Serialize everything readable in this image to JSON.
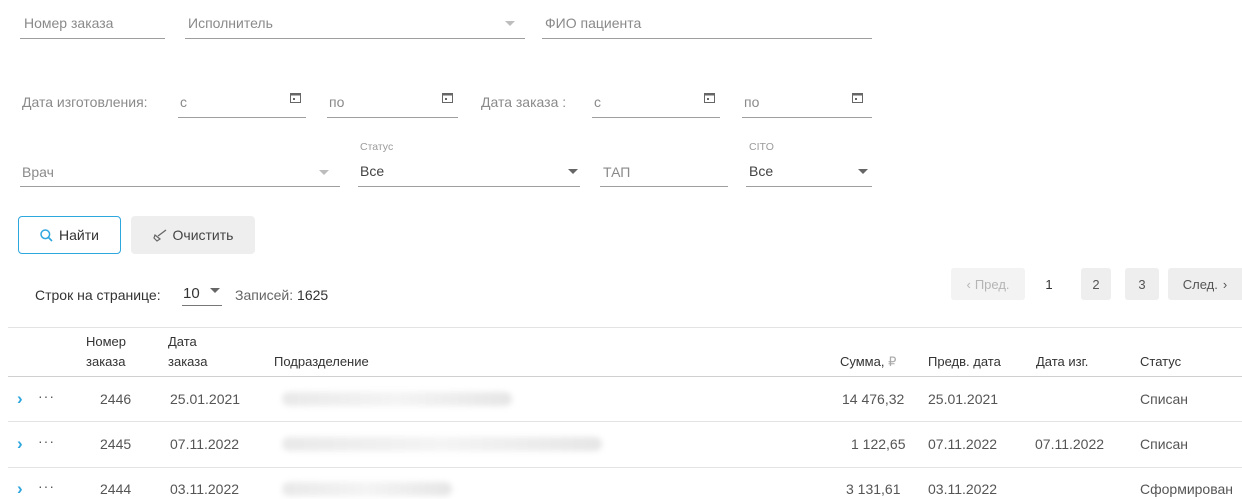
{
  "filters": {
    "order_number": {
      "label": "Номер заказа"
    },
    "executor": {
      "label": "Исполнитель"
    },
    "patient_name": {
      "label": "ФИО пациента"
    },
    "manufacture_date": {
      "label": "Дата изготовления:",
      "from": "с",
      "to": "по"
    },
    "order_date": {
      "label": "Дата заказа :",
      "from": "с",
      "to": "по"
    },
    "doctor": {
      "label": "Врач"
    },
    "status": {
      "label": "Статус",
      "value": "Все"
    },
    "tap": {
      "label": "ТАП"
    },
    "cito": {
      "label": "CITO",
      "value": "Все"
    }
  },
  "buttons": {
    "find": "Найти",
    "clear": "Очистить"
  },
  "pagination": {
    "rows_label": "Строк на странице:",
    "rows_value": "10",
    "records_label": "Записей:",
    "records_count": "1625",
    "prev": "Пред.",
    "next": "След.",
    "pages": [
      "1",
      "2",
      "3"
    ]
  },
  "table": {
    "headers": {
      "order_number": [
        "Номер",
        "заказа"
      ],
      "order_date": [
        "Дата",
        "заказа"
      ],
      "department": "Подразделение",
      "sum": "Сумма,",
      "currency": "₽",
      "planned_date": "Предв. дата",
      "manufacture_date": "Дата изг.",
      "status": "Статус"
    },
    "rows": [
      {
        "number": "2446",
        "date": "25.01.2021",
        "sum": "14 476,32",
        "planned": "25.01.2021",
        "made": "",
        "status": "Списан"
      },
      {
        "number": "2445",
        "date": "07.11.2022",
        "sum": "1 122,65",
        "planned": "07.11.2022",
        "made": "07.11.2022",
        "status": "Списан"
      },
      {
        "number": "2444",
        "date": "03.11.2022",
        "sum": "3 131,61",
        "planned": "03.11.2022",
        "made": "",
        "status": "Сформирован"
      }
    ]
  },
  "colors": {
    "accent": "#2ea6de"
  }
}
